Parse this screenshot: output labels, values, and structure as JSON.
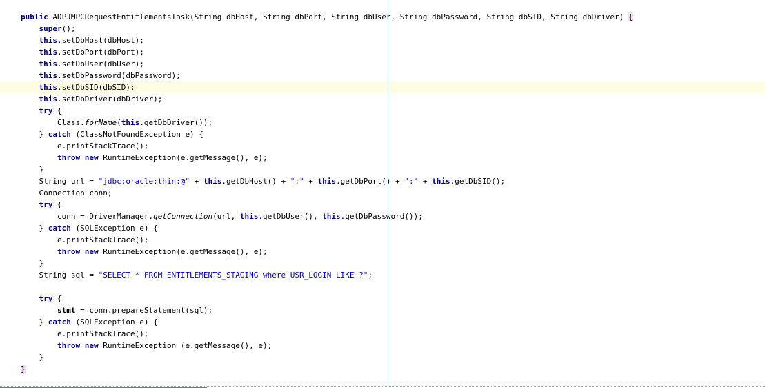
{
  "editor": {
    "current_line_index": 6,
    "colors": {
      "keyword": "#000080",
      "string": "#0000d0",
      "current_line": "#fdfde3",
      "brace_match": "#efd9f3",
      "margin_line": "#a8c4d8"
    },
    "lines": [
      [
        {
          "t": "public",
          "c": "kw"
        },
        {
          "t": " ADPJMPCRequestEntitlementsTask(String dbHost, String dbPort, String dbUser, String dbPassword, String dbSID, String dbDriver) "
        },
        {
          "t": "{",
          "c": "brace"
        }
      ],
      [
        {
          "t": "    "
        },
        {
          "t": "super",
          "c": "kw"
        },
        {
          "t": "();"
        }
      ],
      [
        {
          "t": "    "
        },
        {
          "t": "this",
          "c": "kw"
        },
        {
          "t": ".setDbHost(dbHost);"
        }
      ],
      [
        {
          "t": "    "
        },
        {
          "t": "this",
          "c": "kw"
        },
        {
          "t": ".setDbPort(dbPort);"
        }
      ],
      [
        {
          "t": "    "
        },
        {
          "t": "this",
          "c": "kw"
        },
        {
          "t": ".setDbUser(dbUser);"
        }
      ],
      [
        {
          "t": "    "
        },
        {
          "t": "this",
          "c": "kw"
        },
        {
          "t": ".setDbPassword(dbPassword);"
        }
      ],
      [
        {
          "t": "    "
        },
        {
          "t": "this",
          "c": "kw"
        },
        {
          "t": ".setDbSID(dbSID);"
        }
      ],
      [
        {
          "t": "    "
        },
        {
          "t": "this",
          "c": "kw"
        },
        {
          "t": ".setDbDriver(dbDriver);"
        }
      ],
      [
        {
          "t": "    "
        },
        {
          "t": "try",
          "c": "kw"
        },
        {
          "t": " {"
        }
      ],
      [
        {
          "t": "        Class."
        },
        {
          "t": "forName",
          "c": "ital"
        },
        {
          "t": "("
        },
        {
          "t": "this",
          "c": "kw"
        },
        {
          "t": ".getDbDriver());"
        }
      ],
      [
        {
          "t": "    } "
        },
        {
          "t": "catch",
          "c": "kw"
        },
        {
          "t": " (ClassNotFoundException e) {"
        }
      ],
      [
        {
          "t": "        e.printStackTrace();"
        }
      ],
      [
        {
          "t": "        "
        },
        {
          "t": "throw",
          "c": "kw"
        },
        {
          "t": " "
        },
        {
          "t": "new",
          "c": "kw"
        },
        {
          "t": " RuntimeException(e.getMessage(), e);"
        }
      ],
      [
        {
          "t": "    }"
        }
      ],
      [
        {
          "t": "    String url = "
        },
        {
          "t": "\"jdbc:oracle:thin:@\"",
          "c": "str"
        },
        {
          "t": " + "
        },
        {
          "t": "this",
          "c": "kw"
        },
        {
          "t": ".getDbHost() + "
        },
        {
          "t": "\":\"",
          "c": "str"
        },
        {
          "t": " + "
        },
        {
          "t": "this",
          "c": "kw"
        },
        {
          "t": ".getDbPort() + "
        },
        {
          "t": "\":\"",
          "c": "str"
        },
        {
          "t": " + "
        },
        {
          "t": "this",
          "c": "kw"
        },
        {
          "t": ".getDbSID();"
        }
      ],
      [
        {
          "t": "    Connection conn;"
        }
      ],
      [
        {
          "t": "    "
        },
        {
          "t": "try",
          "c": "kw"
        },
        {
          "t": " {"
        }
      ],
      [
        {
          "t": "        conn = DriverManager."
        },
        {
          "t": "getConnection",
          "c": "ital"
        },
        {
          "t": "(url, "
        },
        {
          "t": "this",
          "c": "kw"
        },
        {
          "t": ".getDbUser(), "
        },
        {
          "t": "this",
          "c": "kw"
        },
        {
          "t": ".getDbPassword());"
        }
      ],
      [
        {
          "t": "    } "
        },
        {
          "t": "catch",
          "c": "kw"
        },
        {
          "t": " (SQLException e) {"
        }
      ],
      [
        {
          "t": "        e.printStackTrace();"
        }
      ],
      [
        {
          "t": "        "
        },
        {
          "t": "throw",
          "c": "kw"
        },
        {
          "t": " "
        },
        {
          "t": "new",
          "c": "kw"
        },
        {
          "t": " RuntimeException(e.getMessage(), e);"
        }
      ],
      [
        {
          "t": "    }"
        }
      ],
      [
        {
          "t": "    String sql = "
        },
        {
          "t": "\"SELECT * FROM ENTITLEMENTS_STAGING where USR_LOGIN LIKE ?\"",
          "c": "str"
        },
        {
          "t": ";"
        }
      ],
      [],
      [
        {
          "t": "    "
        },
        {
          "t": "try",
          "c": "kw"
        },
        {
          "t": " {"
        }
      ],
      [
        {
          "t": "        "
        },
        {
          "t": "stmt",
          "c": "bold"
        },
        {
          "t": " = conn.prepareStatement(sql);"
        }
      ],
      [
        {
          "t": "    } "
        },
        {
          "t": "catch",
          "c": "kw"
        },
        {
          "t": " (SQLException e) {"
        }
      ],
      [
        {
          "t": "        e.printStackTrace();"
        }
      ],
      [
        {
          "t": "        "
        },
        {
          "t": "throw",
          "c": "kw"
        },
        {
          "t": " "
        },
        {
          "t": "new",
          "c": "kw"
        },
        {
          "t": " RuntimeException (e.getMessage(), e);"
        }
      ],
      [
        {
          "t": "    }"
        }
      ],
      [
        {
          "t": "}",
          "c": "brace"
        }
      ]
    ]
  }
}
